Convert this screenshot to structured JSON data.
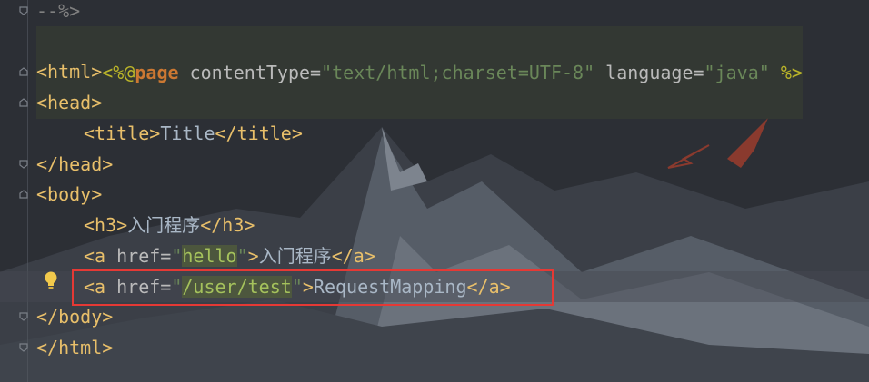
{
  "editor": {
    "lines": {
      "l0": {
        "comment_end": "--%>"
      },
      "l1": {
        "open": "<%@",
        "keyword": "page",
        "attr1": " contentType=",
        "val1": "\"text/html;charset=UTF-8\"",
        "attr2": " language=",
        "val2": "\"java\"",
        "close": " %>"
      },
      "l2": {
        "lt": "<",
        "tag": "html",
        "gt": ">"
      },
      "l3": {
        "lt": "<",
        "tag": "head",
        "gt": ">"
      },
      "l4": {
        "lt1": "<",
        "tag1": "title",
        "gt1": ">",
        "text": "Title",
        "lt2": "</",
        "tag2": "title",
        "gt2": ">"
      },
      "l5": {
        "lt": "</",
        "tag": "head",
        "gt": ">"
      },
      "l6": {
        "lt": "<",
        "tag": "body",
        "gt": ">"
      },
      "l7": {
        "lt1": "<",
        "tag1": "h3",
        "gt1": ">",
        "text": "入门程序",
        "lt2": "</",
        "tag2": "h3",
        "gt2": ">"
      },
      "l8": {
        "lt1": "<",
        "tag1": "a",
        "attr": " href=",
        "q1": "\"",
        "val": "hello",
        "q2": "\"",
        "gt1": ">",
        "text": "入门程序",
        "lt2": "</",
        "tag2": "a",
        "gt2": ">"
      },
      "l9": {
        "lt1": "<",
        "tag1": "a",
        "attr": " href=",
        "q1": "\"",
        "val": "/user/test",
        "q2": "\"",
        "gt1": ">",
        "text": "RequestMapping",
        "lt2": "</",
        "tag2": "a",
        "gt2": ">"
      },
      "l10": {
        "lt": "</",
        "tag": "body",
        "gt": ">"
      },
      "l11": {
        "lt": "</",
        "tag": "html",
        "gt": ">"
      }
    },
    "colors": {
      "tag": "#e8bf6a",
      "string": "#6a8759",
      "text": "#a9b7c6",
      "keyword": "#cc7832",
      "highlight_box": "#e53935",
      "bulb": "#f2c94c"
    },
    "icons": {
      "intention": "lightbulb-icon",
      "fold": "fold-marker-icon"
    }
  }
}
